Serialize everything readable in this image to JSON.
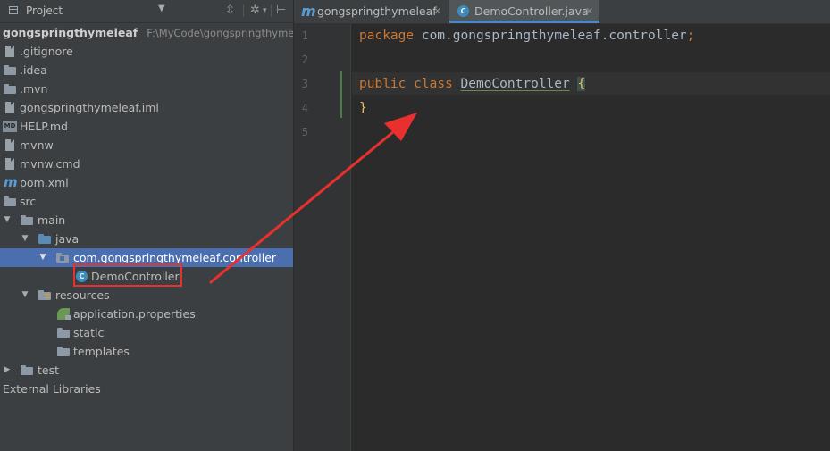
{
  "project_panel": {
    "title": "Project",
    "tree": [
      {
        "label": "gongspringthymeleaf",
        "path": "F:\\MyCode\\gongspringthymeleaf",
        "icon": "none",
        "level": 0
      },
      {
        "label": ".gitignore",
        "icon": "file-icon",
        "level": 0
      },
      {
        "label": ".idea",
        "icon": "folder-icon",
        "level": 0
      },
      {
        "label": ".mvn",
        "icon": "folder-icon",
        "level": 0
      },
      {
        "label": "gongspringthymeleaf.iml",
        "icon": "file-icon",
        "level": 0
      },
      {
        "label": "HELP.md",
        "icon": "markdown-icon",
        "level": 0
      },
      {
        "label": "mvnw",
        "icon": "file-icon",
        "level": 0
      },
      {
        "label": "mvnw.cmd",
        "icon": "file-icon",
        "level": 0
      },
      {
        "label": "pom.xml",
        "icon": "maven-icon",
        "level": 0
      },
      {
        "label": "src",
        "icon": "folder-icon",
        "level": 0
      },
      {
        "label": "main",
        "icon": "folder-icon",
        "level": 1,
        "expanded": true
      },
      {
        "label": "java",
        "icon": "source-folder-icon",
        "level": 2,
        "expanded": true
      },
      {
        "label": "com.gongspringthymeleaf.controller",
        "icon": "package-icon",
        "level": 3,
        "expanded": true,
        "selected": true
      },
      {
        "label": "DemoController",
        "icon": "class-icon",
        "level": 4
      },
      {
        "label": "resources",
        "icon": "resources-folder-icon",
        "level": 2,
        "expanded": true
      },
      {
        "label": "application.properties",
        "icon": "spring-properties-icon",
        "level": 3
      },
      {
        "label": "static",
        "icon": "folder-icon",
        "level": 3
      },
      {
        "label": "templates",
        "icon": "folder-icon",
        "level": 3
      },
      {
        "label": "test",
        "icon": "folder-icon",
        "level": 1,
        "expanded": false
      },
      {
        "label": "External Libraries",
        "icon": "none",
        "level": 0
      }
    ]
  },
  "tabs": [
    {
      "label": "gongspringthymeleaf",
      "icon": "maven-icon",
      "active": false
    },
    {
      "label": "DemoController.java",
      "icon": "class-icon",
      "active": true
    }
  ],
  "editor": {
    "line_numbers": [
      "1",
      "2",
      "3",
      "4",
      "5"
    ],
    "package_kw": "package",
    "package_name": "com.gongspringthymeleaf.controller",
    "semicolon": ";",
    "public_kw": "public",
    "class_kw": "class",
    "class_name": "DemoController",
    "open_brace": "{",
    "close_brace": "}"
  },
  "colors": {
    "selection": "#4b6eaf",
    "keyword": "#cc7832",
    "annotation_red": "#e8312f"
  }
}
